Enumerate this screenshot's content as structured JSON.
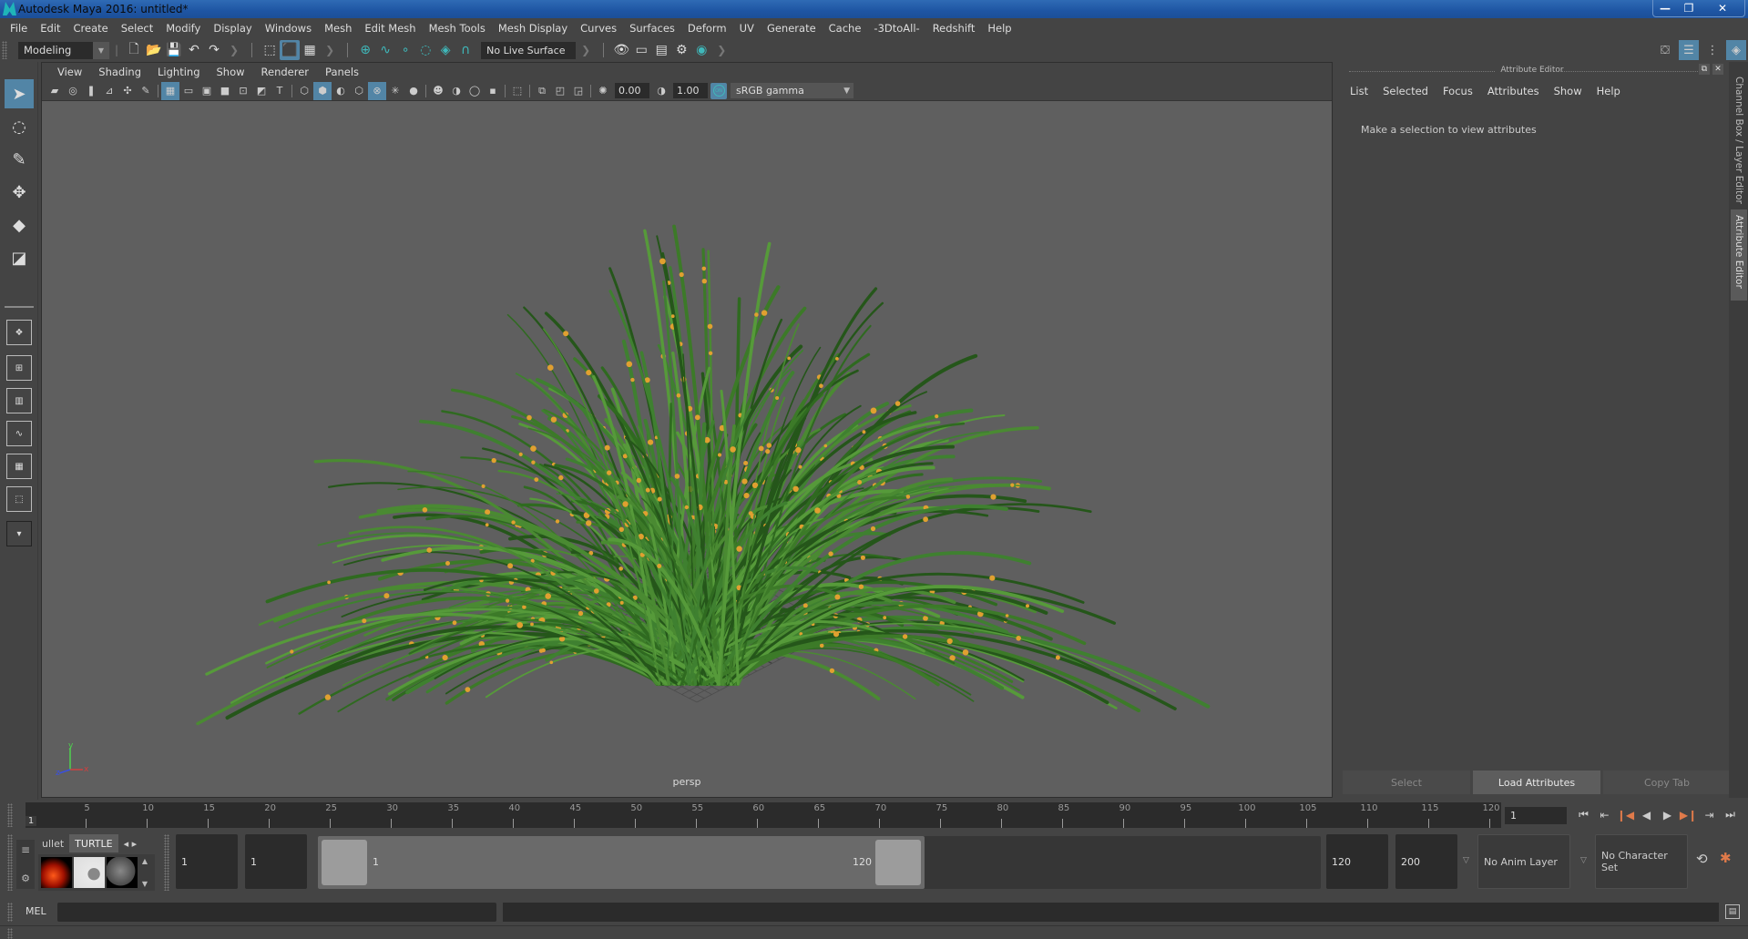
{
  "window": {
    "title": "Autodesk Maya 2016: untitled*",
    "controls": {
      "minimize": "—",
      "restore": "❐",
      "close": "✕"
    }
  },
  "menubar": [
    "File",
    "Edit",
    "Create",
    "Select",
    "Modify",
    "Display",
    "Windows",
    "Mesh",
    "Edit Mesh",
    "Mesh Tools",
    "Mesh Display",
    "Curves",
    "Surfaces",
    "Deform",
    "UV",
    "Generate",
    "Cache",
    "-3DtoAll-",
    "Redshift",
    "Help"
  ],
  "statusline": {
    "mode": "Modeling",
    "live_surface": "No Live Surface"
  },
  "viewport": {
    "menu": [
      "View",
      "Shading",
      "Lighting",
      "Show",
      "Renderer",
      "Panels"
    ],
    "exposure": "0.00",
    "gamma": "1.00",
    "color_management_toggle": "ON",
    "color_space": "sRGB gamma",
    "camera_label": "persp",
    "axis": {
      "x": "x",
      "y": "y",
      "z": "z"
    },
    "scene_object": "grass bush with orange flowers on grid"
  },
  "attribute_editor": {
    "title": "Attribute Editor",
    "menu": [
      "List",
      "Selected",
      "Focus",
      "Attributes",
      "Show",
      "Help"
    ],
    "empty_message": "Make a selection to view attributes",
    "buttons": {
      "select": "Select",
      "load": "Load Attributes",
      "copy": "Copy Tab"
    }
  },
  "side_tabs": [
    "Channel Box / Layer Editor",
    "Attribute Editor"
  ],
  "timeline": {
    "start_label": "1",
    "ticks": [
      5,
      10,
      15,
      20,
      25,
      30,
      35,
      40,
      45,
      50,
      55,
      60,
      65,
      70,
      75,
      80,
      85,
      90,
      95,
      100,
      105,
      110,
      115,
      120
    ],
    "current_frame": "1",
    "playback": [
      "go-to-start",
      "step-back-key",
      "step-back-frame",
      "play-backward",
      "play-forward",
      "step-forward-frame",
      "step-forward-key",
      "go-to-end"
    ]
  },
  "range": {
    "shelf_tabs": [
      "ullet",
      "TURTLE"
    ],
    "start_time": "1",
    "playback_start": "1",
    "range_min_label": "1",
    "range_max_label": "120",
    "playback_end": "120",
    "end_time": "200",
    "anim_layer": "No Anim Layer",
    "character_set": "No Character Set"
  },
  "command_line": {
    "language": "MEL",
    "input": "",
    "output": ""
  },
  "colors": {
    "accent": "#5285a6",
    "teal": "#3fb8ba",
    "orange": "#e07a4a",
    "viewport_bg": "#5f5f5f",
    "grass": "#3f7a2a",
    "flower": "#e0a030"
  }
}
